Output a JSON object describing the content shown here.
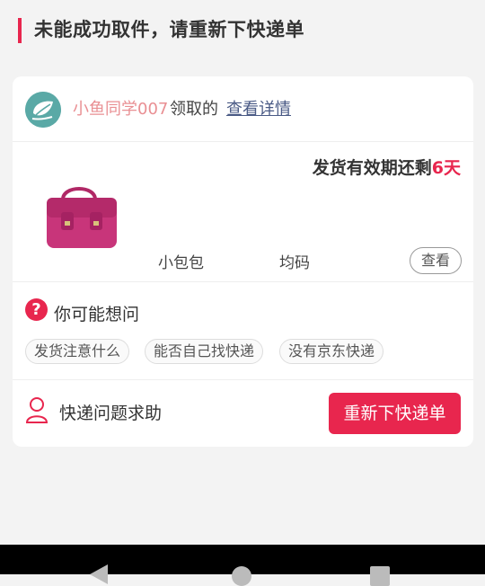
{
  "header": {
    "title": "未能成功取件，请重新下快递单"
  },
  "sender": {
    "name": "小鱼同学007",
    "verb": "领取的",
    "detail_link": "查看详情"
  },
  "product": {
    "validity_prefix": "发货有效期还剩",
    "validity_days": "6天",
    "name": "小包包",
    "size": "均码",
    "view_label": "查看"
  },
  "faq": {
    "heading": "你可能想问",
    "chips": [
      "发货注意什么",
      "能否自己找快递",
      "没有京东快递"
    ]
  },
  "help": {
    "label": "快递问题求助",
    "button": "重新下快递单"
  },
  "colors": {
    "accent": "#e8264e",
    "name": "#e98f93",
    "link": "#4a5a85"
  },
  "icons": [
    "avatar-leaf-icon",
    "question-icon",
    "person-icon",
    "nav-back-icon",
    "nav-home-icon",
    "nav-recent-icon"
  ]
}
